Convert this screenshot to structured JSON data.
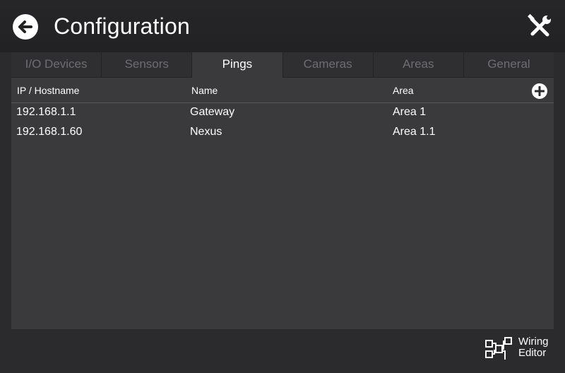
{
  "header": {
    "title": "Configuration",
    "back_icon": "arrow-left-icon",
    "tools_icon": "wrench-screwdriver-icon"
  },
  "tabs": [
    {
      "label": "I/O Devices",
      "active": false
    },
    {
      "label": "Sensors",
      "active": false
    },
    {
      "label": "Pings",
      "active": true
    },
    {
      "label": "Cameras",
      "active": false
    },
    {
      "label": "Areas",
      "active": false
    },
    {
      "label": "General",
      "active": false
    }
  ],
  "table": {
    "columns": [
      "IP / Hostname",
      "Name",
      "Area"
    ],
    "add_icon": "plus-circle-icon",
    "rows": [
      {
        "ip": "192.168.1.1",
        "name": "Gateway",
        "area": "Area 1"
      },
      {
        "ip": "192.168.1.60",
        "name": "Nexus",
        "area": "Area 1.1"
      }
    ]
  },
  "footer": {
    "wiring_editor_line1": "Wiring",
    "wiring_editor_line2": "Editor",
    "wiring_icon": "wiring-diagram-icon"
  },
  "colors": {
    "background": "#2b2b2d",
    "panel": "#3a3a3c",
    "inactive_tab_text": "#6e6e72",
    "text": "#ffffff"
  }
}
